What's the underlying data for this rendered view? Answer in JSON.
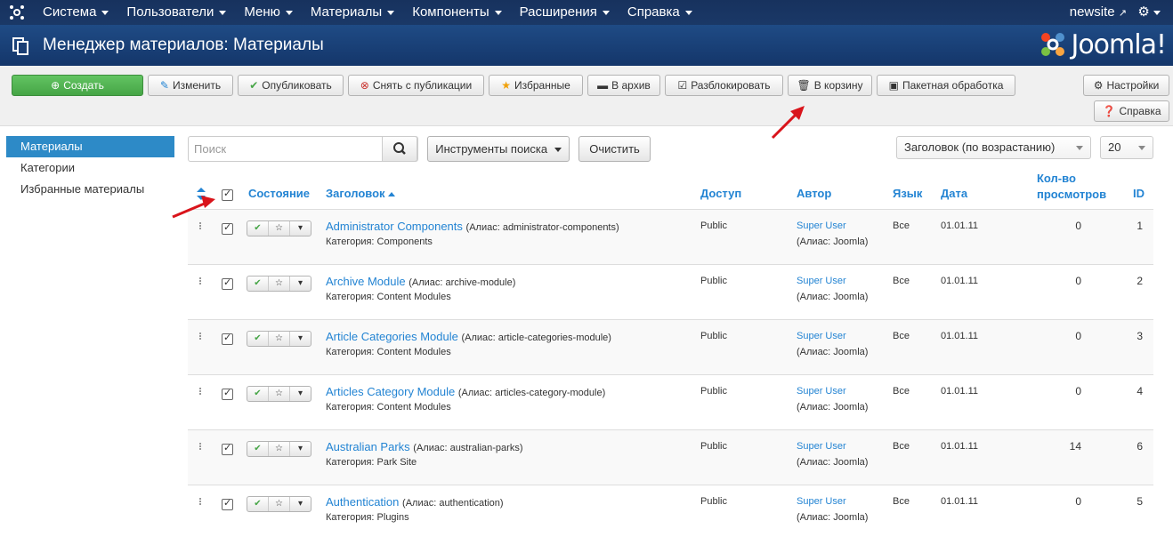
{
  "nav": {
    "items": [
      "Система",
      "Пользователи",
      "Меню",
      "Материалы",
      "Компоненты",
      "Расширения",
      "Справка"
    ],
    "site": "newsite"
  },
  "header": {
    "title": "Менеджер материалов: Материалы",
    "brand": "Joomla!"
  },
  "toolbar": {
    "create": "Создать",
    "edit": "Изменить",
    "publish": "Опубликовать",
    "unpublish": "Снять с публикации",
    "featured": "Избранные",
    "archive": "В архив",
    "checkin": "Разблокировать",
    "trash": "В корзину",
    "batch": "Пакетная обработка",
    "options": "Настройки",
    "help": "Справка"
  },
  "sidebar": {
    "items": [
      "Материалы",
      "Категории",
      "Избранные материалы"
    ]
  },
  "filters": {
    "search_placeholder": "Поиск",
    "search_tools": "Инструменты поиска",
    "clear": "Очистить",
    "ordering": "Заголовок (по возрастанию)",
    "limit": "20"
  },
  "table": {
    "headers": {
      "status": "Состояние",
      "title": "Заголовок",
      "access": "Доступ",
      "author": "Автор",
      "language": "Язык",
      "date": "Дата",
      "hits_1": "Кол-во",
      "hits_2": "просмотров",
      "id": "ID"
    },
    "rows": [
      {
        "title": "Administrator Components",
        "alias": "(Алиас: administrator-components)",
        "category": "Категория: Components",
        "access": "Public",
        "author": "Super User",
        "author_alias": "(Алиас: Joomla)",
        "language": "Все",
        "date": "01.01.11",
        "hits": "0",
        "id": "1"
      },
      {
        "title": "Archive Module",
        "alias": "(Алиас: archive-module)",
        "category": "Категория: Content Modules",
        "access": "Public",
        "author": "Super User",
        "author_alias": "(Алиас: Joomla)",
        "language": "Все",
        "date": "01.01.11",
        "hits": "0",
        "id": "2"
      },
      {
        "title": "Article Categories Module",
        "alias": "(Алиас: article-categories-module)",
        "category": "Категория: Content Modules",
        "access": "Public",
        "author": "Super User",
        "author_alias": "(Алиас: Joomla)",
        "language": "Все",
        "date": "01.01.11",
        "hits": "0",
        "id": "3"
      },
      {
        "title": "Articles Category Module",
        "alias": "(Алиас: articles-category-module)",
        "category": "Категория: Content Modules",
        "access": "Public",
        "author": "Super User",
        "author_alias": "(Алиас: Joomla)",
        "language": "Все",
        "date": "01.01.11",
        "hits": "0",
        "id": "4"
      },
      {
        "title": "Australian Parks",
        "alias": "(Алиас: australian-parks)",
        "category": "Категория: Park Site",
        "access": "Public",
        "author": "Super User",
        "author_alias": "(Алиас: Joomla)",
        "language": "Все",
        "date": "01.01.11",
        "hits": "14",
        "id": "6"
      },
      {
        "title": "Authentication",
        "alias": "(Алиас: authentication)",
        "category": "Категория: Plugins",
        "access": "Public",
        "author": "Super User",
        "author_alias": "(Алиас: Joomla)",
        "language": "Все",
        "date": "01.01.11",
        "hits": "0",
        "id": "5"
      }
    ]
  },
  "colors": {
    "link": "#2384d3",
    "header_bg": "#1a3867",
    "success": "#46a546",
    "annotation": "#d9141b"
  }
}
